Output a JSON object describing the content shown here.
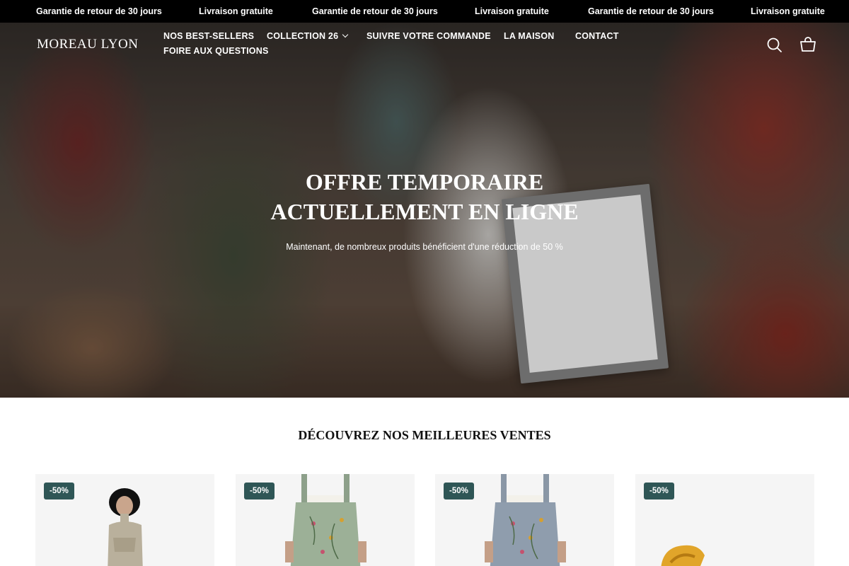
{
  "announcement": {
    "items": [
      "Garantie de retour de 30 jours",
      "Livraison gratuite",
      "Garantie de retour de 30 jours",
      "Livraison gratuite",
      "Garantie de retour de 30 jours",
      "Livraison gratuite"
    ]
  },
  "header": {
    "logo": "MOREAU LYON",
    "nav": [
      "NOS BEST-SELLERS",
      "COLLECTION 26",
      "SUIVRE VOTRE COMMANDE",
      "LA MAISON",
      "CONTACT",
      "FOIRE AUX QUESTIONS"
    ],
    "icons": [
      "search-icon",
      "cart-icon"
    ]
  },
  "hero": {
    "title": "OFFRE TEMPORAIRE ACTUELLEMENT EN LIGNE",
    "subtitle": "Maintenant, de nombreux produits bénéficient d'une réduction de 50 %"
  },
  "bestsellers": {
    "title": "DÉCOUVREZ NOS MEILLEURES VENTES",
    "products": [
      {
        "badge": "-50%"
      },
      {
        "badge": "-50%"
      },
      {
        "badge": "-50%"
      },
      {
        "badge": "-50%"
      }
    ]
  },
  "colors": {
    "announcement_bg": "#000000",
    "badge_bg": "#2f5656",
    "card_bg": "#f5f5f5"
  }
}
